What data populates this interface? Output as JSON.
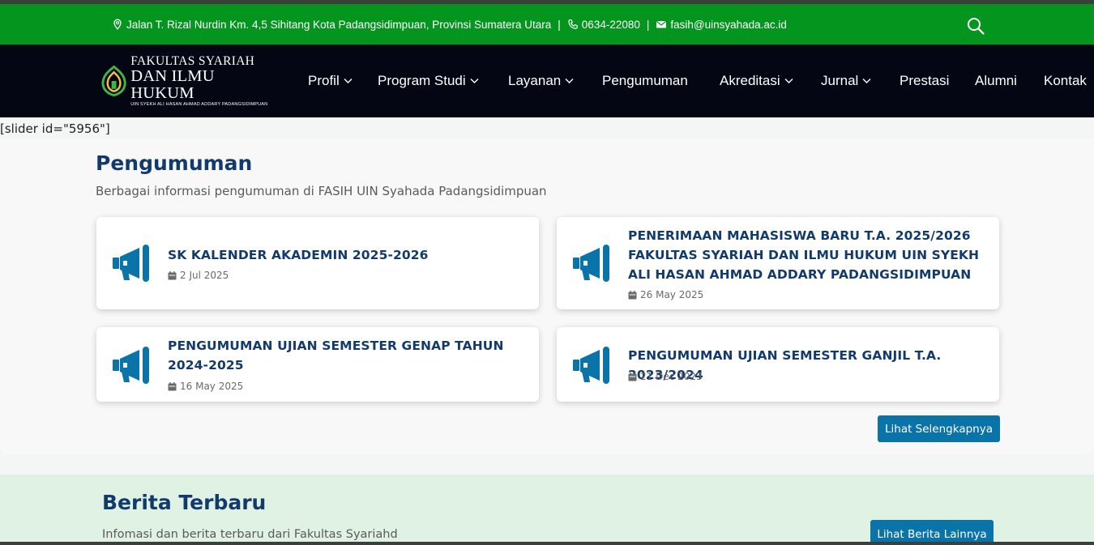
{
  "topbar": {
    "address": "Jalan T. Rizal Nurdin Km. 4,5 Sihitang Kota Padangsidimpuan, Provinsi Sumatera Utara",
    "phone": "0634-22080",
    "email": "fasih@uinsyahada.ac.id",
    "separator": "|"
  },
  "logo": {
    "line1": "FAKULTAS SYARIAH",
    "line2": "DAN ILMU HUKUM",
    "line3": "UIN SYEKH ALI HASAN AHMAD ADDARY PADANGSIDIMPUAN"
  },
  "nav": {
    "items": [
      {
        "label": "Profil",
        "dropdown": true
      },
      {
        "label": "Program Studi",
        "dropdown": true
      },
      {
        "label": "Layanan",
        "dropdown": true
      },
      {
        "label": "Pengumuman",
        "dropdown": false
      },
      {
        "label": "Akreditasi",
        "dropdown": true
      },
      {
        "label": "Jurnal",
        "dropdown": true
      },
      {
        "label": "Prestasi",
        "dropdown": false
      },
      {
        "label": "Alumni",
        "dropdown": false
      },
      {
        "label": "Kontak",
        "dropdown": false
      }
    ]
  },
  "slider_shortcode": "[slider id=\"5956\"]",
  "announcements": {
    "title": "Pengumuman",
    "subtitle": "Berbagai informasi pengumuman di FASIH UIN Syahada Padangsidimpuan",
    "items": [
      {
        "title": "SK KALENDER AKADEMIN 2025-2026",
        "date": "2 Jul 2025"
      },
      {
        "title": "PENERIMAAN MAHASISWA BARU T.A. 2025/2026 FAKULTAS SYARIAH DAN ILMU HUKUM UIN SYEKH ALI HASAN AHMAD ADDARY PADANGSIDIMPUAN",
        "date": "26 May 2025"
      },
      {
        "title": "PENGUMUMAN UJIAN SEMESTER GENAP TAHUN 2024-2025",
        "date": "16 May 2025"
      },
      {
        "title": "PENGUMUMAN UJIAN SEMESTER GANJIL T.A. 2023/2024",
        "date": "21 Dec 2023"
      }
    ],
    "more_button": "Lihat Selengkapnya"
  },
  "news": {
    "title": "Berita Terbaru",
    "subtitle": "Infomasi dan berita terbaru dari Fakultas Syariahd",
    "more_button": "Lihat Berita Lainnya"
  },
  "colors": {
    "topbar_bg": "#04951f",
    "navbar_bg": "#040613",
    "heading": "#123a6d",
    "accent": "#0a73a8",
    "news_bg": "#dff2e3"
  },
  "icons": [
    "map-pin-icon",
    "phone-icon",
    "mail-icon",
    "search-icon",
    "chevron-down-icon",
    "megaphone-icon",
    "calendar-icon"
  ]
}
